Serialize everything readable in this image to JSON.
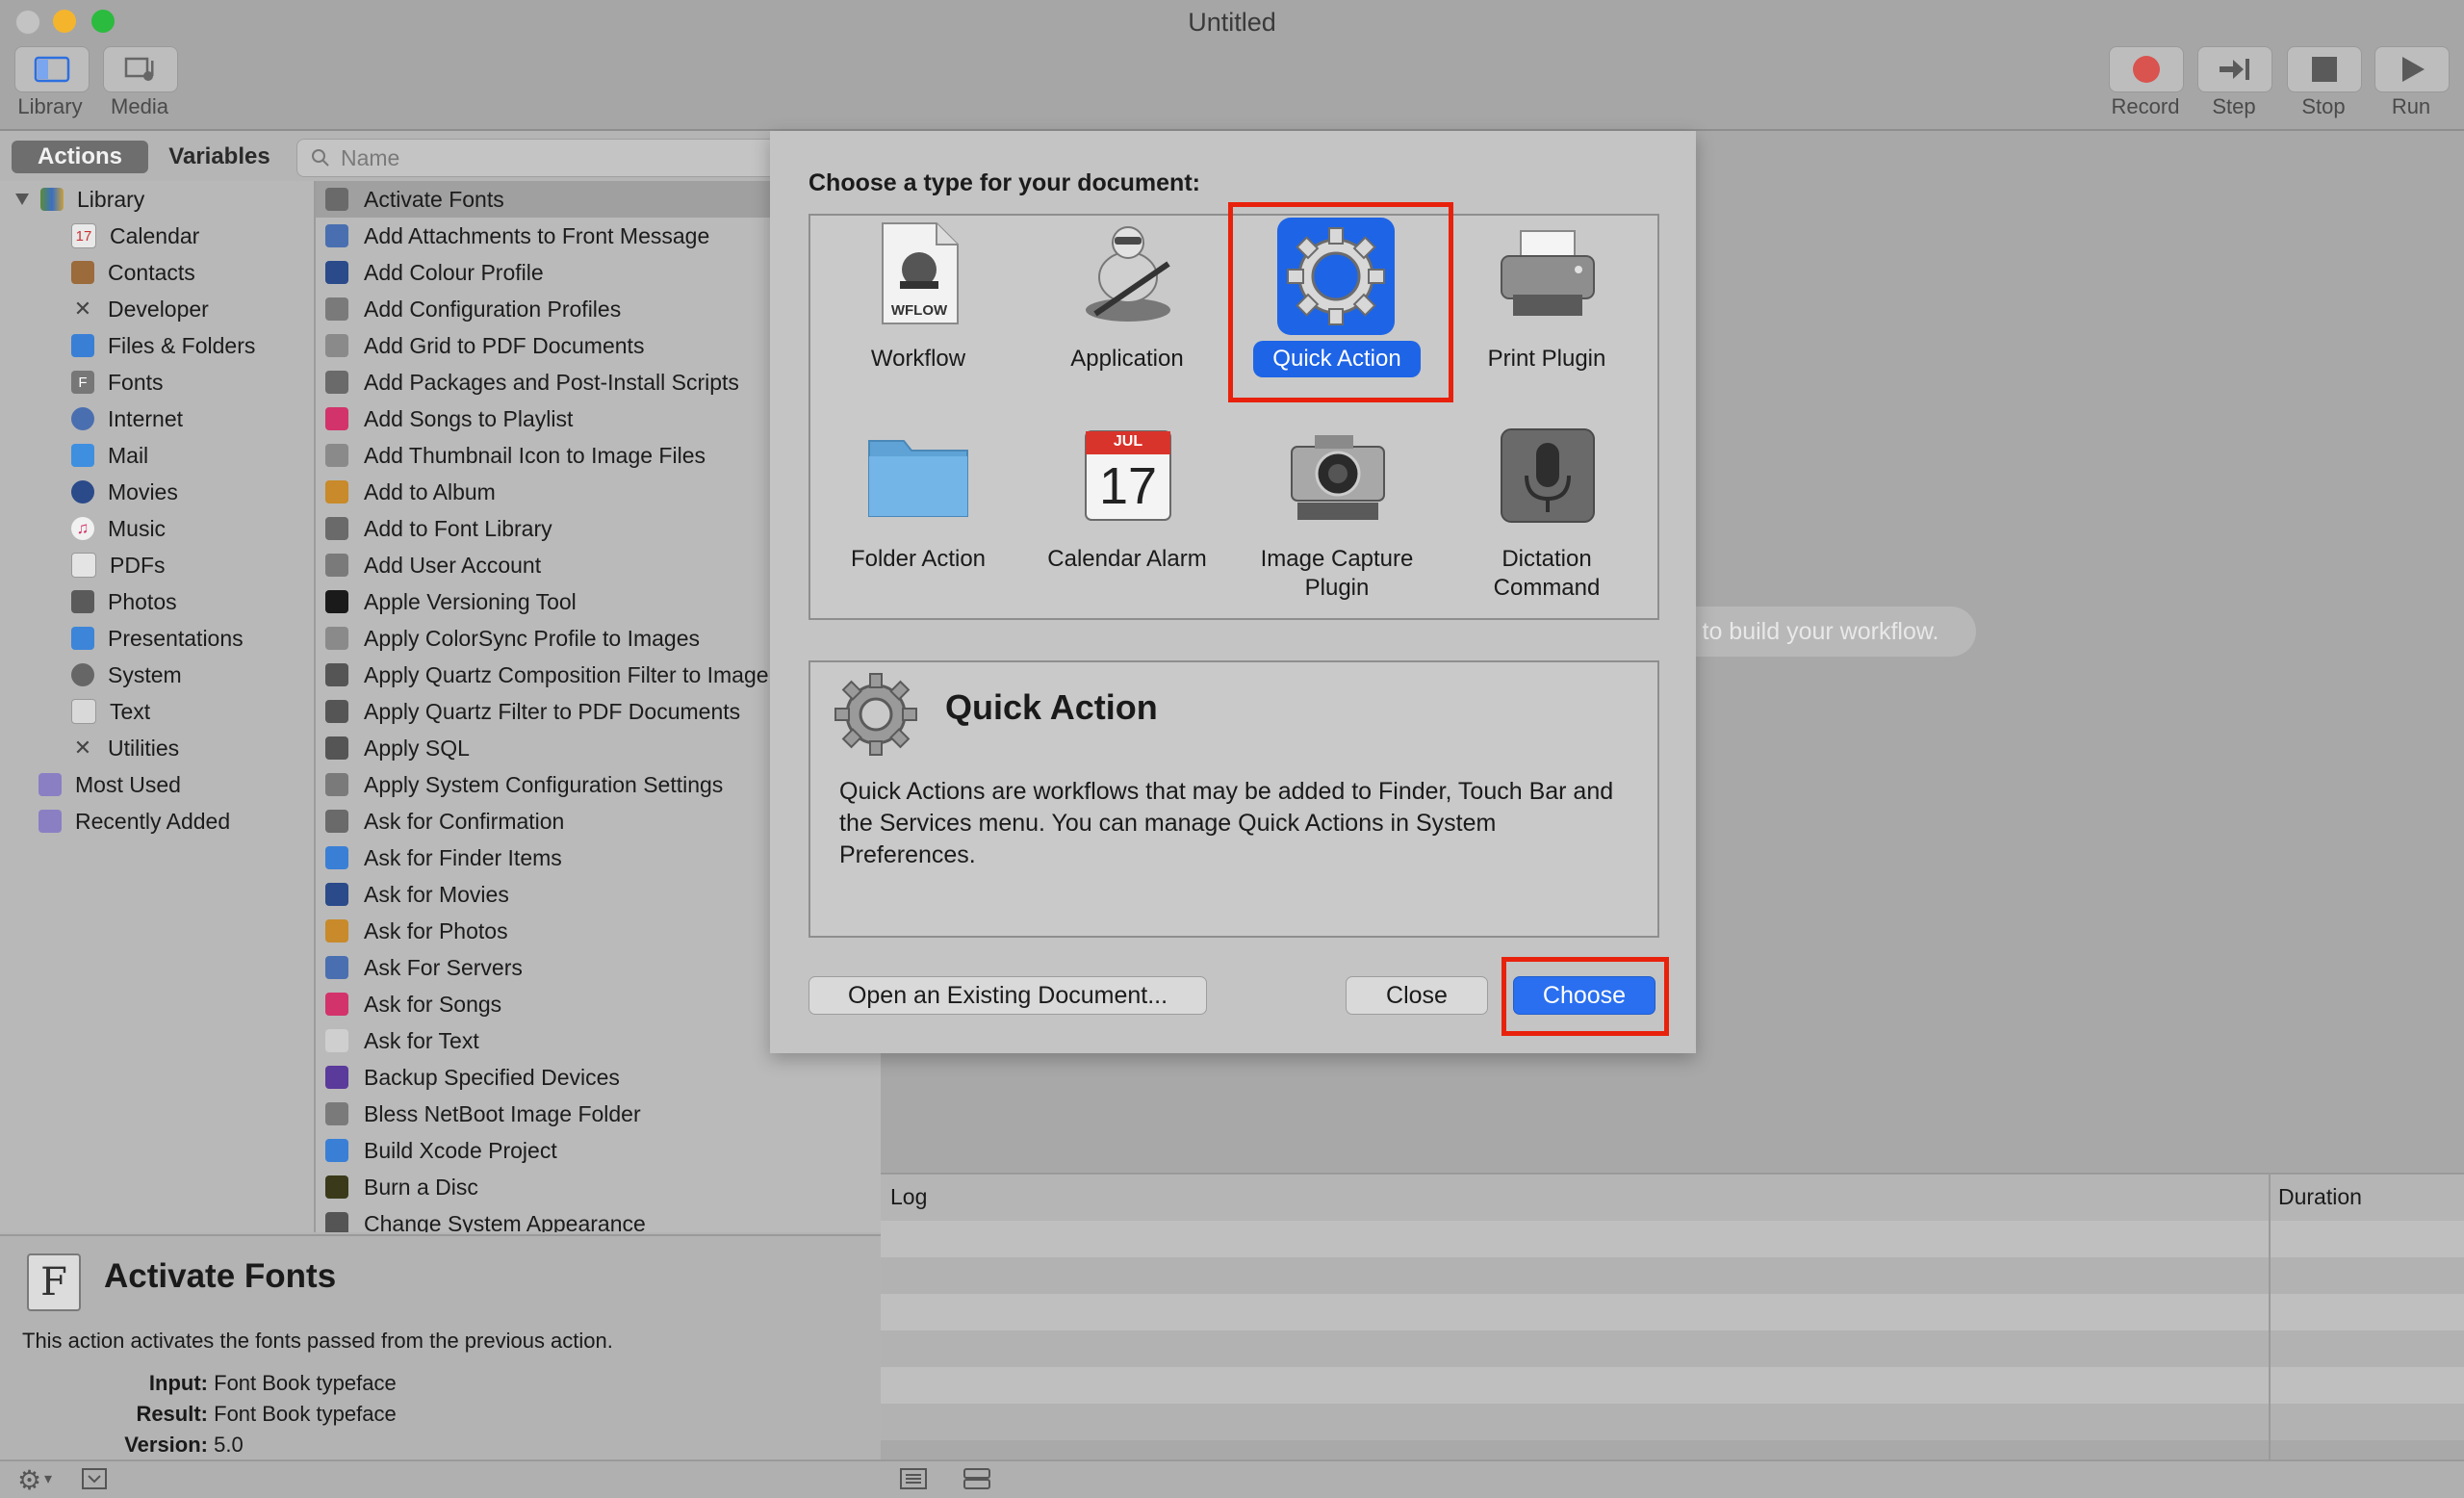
{
  "window": {
    "title": "Untitled"
  },
  "toolbar": {
    "library_label": "Library",
    "media_label": "Media",
    "record_label": "Record",
    "step_label": "Step",
    "stop_label": "Stop",
    "run_label": "Run"
  },
  "sidebar": {
    "tab_actions": "Actions",
    "tab_variables": "Variables",
    "search_placeholder": "Name",
    "library_root": "Library",
    "library_items": [
      "Calendar",
      "Contacts",
      "Developer",
      "Files & Folders",
      "Fonts",
      "Internet",
      "Mail",
      "Movies",
      "Music",
      "PDFs",
      "Photos",
      "Presentations",
      "System",
      "Text",
      "Utilities"
    ],
    "smart_groups": [
      "Most Used",
      "Recently Added"
    ],
    "actions": [
      "Activate Fonts",
      "Add Attachments to Front Message",
      "Add Colour Profile",
      "Add Configuration Profiles",
      "Add Grid to PDF Documents",
      "Add Packages and Post-Install Scripts",
      "Add Songs to Playlist",
      "Add Thumbnail Icon to Image Files",
      "Add to Album",
      "Add to Font Library",
      "Add User Account",
      "Apple Versioning Tool",
      "Apply ColorSync Profile to Images",
      "Apply Quartz Composition Filter to Image Files",
      "Apply Quartz Filter to PDF Documents",
      "Apply SQL",
      "Apply System Configuration Settings",
      "Ask for Confirmation",
      "Ask for Finder Items",
      "Ask for Movies",
      "Ask for Photos",
      "Ask For Servers",
      "Ask for Songs",
      "Ask for Text",
      "Backup Specified Devices",
      "Bless NetBoot Image Folder",
      "Build Xcode Project",
      "Burn a Disc",
      "Change System Appearance"
    ]
  },
  "description": {
    "title": "Activate Fonts",
    "text": "This action activates the fonts passed from the previous action.",
    "input_label": "Input:",
    "input_value": "Font Book typeface",
    "result_label": "Result:",
    "result_value": "Font Book typeface",
    "version_label": "Version:",
    "version_value": "5.0"
  },
  "workflow": {
    "hint": "to build your workflow.",
    "log_header": "Log",
    "duration_header": "Duration"
  },
  "sheet": {
    "prompt": "Choose a type for your document:",
    "types": {
      "workflow": "Workflow",
      "application": "Application",
      "quick_action": "Quick Action",
      "print_plugin": "Print Plugin",
      "folder_action": "Folder Action",
      "calendar_alarm": "Calendar Alarm",
      "image_capture_line1": "Image Capture",
      "image_capture_line2": "Plugin",
      "dictation_line1": "Dictation",
      "dictation_line2": "Command"
    },
    "workflow_icon_text": "WFLOW",
    "calendar_month": "JUL",
    "calendar_day": "17",
    "info_title": "Quick Action",
    "info_text": "Quick Actions are workflows that may be added to Finder, Touch Bar and the Services menu. You can manage Quick Actions in System Preferences.",
    "open_button": "Open an Existing Document...",
    "close_button": "Close",
    "choose_button": "Choose"
  },
  "colors": {
    "accent": "#2a6ff0",
    "highlight": "#e8210c"
  }
}
